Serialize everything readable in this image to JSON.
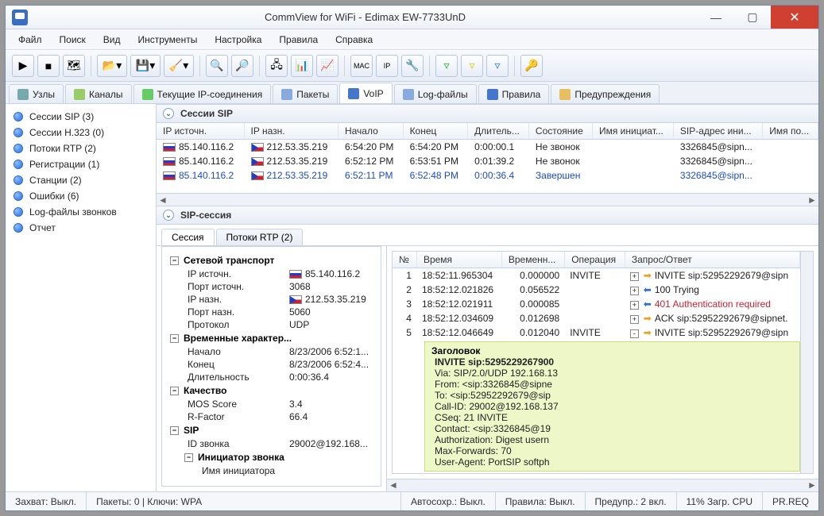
{
  "title": "CommView for WiFi - Edimax EW-7733UnD",
  "menu": [
    "Файл",
    "Поиск",
    "Вид",
    "Инструменты",
    "Настройка",
    "Правила",
    "Справка"
  ],
  "maintabs": [
    {
      "label": "Узлы",
      "icon": "#7aa"
    },
    {
      "label": "Каналы",
      "icon": "#9c6"
    },
    {
      "label": "Текущие IP-соединения",
      "icon": "#6c6"
    },
    {
      "label": "Пакеты",
      "icon": "#8ad"
    },
    {
      "label": "VoIP",
      "icon": "#47c",
      "active": true
    },
    {
      "label": "Log-файлы",
      "icon": "#8ad"
    },
    {
      "label": "Правила",
      "icon": "#47c"
    },
    {
      "label": "Предупреждения",
      "icon": "#e6c060"
    }
  ],
  "sidebar": [
    "Сессии SIP  (3)",
    "Сессии H.323 (0)",
    "Потоки RTP (2)",
    "Регистрации (1)",
    "Станции (2)",
    "Ошибки (6)",
    "Log-файлы звонков",
    "Отчет"
  ],
  "sessions_title": "Сессии SIP",
  "sessions_cols": [
    "IP источн.",
    "IP назн.",
    "Начало",
    "Конец",
    "Длитель...",
    "Состояние",
    "Имя инициат...",
    "SIP-адрес ини...",
    "Имя по..."
  ],
  "sessions_rows": [
    {
      "src": "85.140.116.2",
      "dst": "212.53.35.219",
      "start": "6:54:20 PM",
      "end": "6:54:20 PM",
      "dur": "0:00:00.1",
      "state": "Не звонок",
      "init": "",
      "sip": "3326845@sipn..."
    },
    {
      "src": "85.140.116.2",
      "dst": "212.53.35.219",
      "start": "6:52:12 PM",
      "end": "6:53:51 PM",
      "dur": "0:01:39.2",
      "state": "Не звонок",
      "init": "",
      "sip": "3326845@sipn..."
    },
    {
      "src": "85.140.116.2",
      "dst": "212.53.35.219",
      "start": "6:52:11 PM",
      "end": "6:52:48 PM",
      "dur": "0:00:36.4",
      "state": "Завершен",
      "init": "",
      "sip": "3326845@sipn...",
      "sel": true
    }
  ],
  "sip_session_title": "SIP-сессия",
  "subtabs": [
    "Сессия",
    "Потоки RTP (2)"
  ],
  "detail": {
    "net_transport": "Сетевой транспорт",
    "ip_src_k": "IP источн.",
    "ip_src_v": "85.140.116.2",
    "port_src_k": "Порт источн.",
    "port_src_v": "3068",
    "ip_dst_k": "IP назн.",
    "ip_dst_v": "212.53.35.219",
    "port_dst_k": "Порт назн.",
    "port_dst_v": "5060",
    "proto_k": "Протокол",
    "proto_v": "UDP",
    "timing": "Временные характер...",
    "start_k": "Начало",
    "start_v": "8/23/2006 6:52:1...",
    "end_k": "Конец",
    "end_v": "8/23/2006 6:52:4...",
    "dur_k": "Длительность",
    "dur_v": "0:00:36.4",
    "quality": "Качество",
    "mos_k": "MOS Score",
    "mos_v": "3.4",
    "rf_k": "R-Factor",
    "rf_v": "66.4",
    "sip": "SIP",
    "callid_k": "ID звонка",
    "callid_v": "29002@192.168...",
    "caller": "Инициатор звонка",
    "caller_name": "Имя инициатора"
  },
  "msg_cols": [
    "№",
    "Время",
    "Временн...",
    "Операция",
    "Запрос/Ответ"
  ],
  "msgs": [
    {
      "n": "1",
      "t": "18:52:11.965304",
      "dt": "0.000000",
      "op": "INVITE",
      "dir": "out",
      "txt": "INVITE sip:52952292679@sipn",
      "ex": "+"
    },
    {
      "n": "2",
      "t": "18:52:12.021826",
      "dt": "0.056522",
      "op": "",
      "dir": "in",
      "txt": "100 Trying",
      "ex": "+"
    },
    {
      "n": "3",
      "t": "18:52:12.021911",
      "dt": "0.000085",
      "op": "",
      "dir": "in",
      "txt": "401 Authentication required",
      "ex": "+",
      "red": true
    },
    {
      "n": "4",
      "t": "18:52:12.034609",
      "dt": "0.012698",
      "op": "",
      "dir": "out",
      "txt": "ACK sip:52952292679@sipnet.",
      "ex": "+"
    },
    {
      "n": "5",
      "t": "18:52:12.046649",
      "dt": "0.012040",
      "op": "INVITE",
      "dir": "out",
      "txt": "INVITE sip:52952292679@sipn",
      "ex": "-"
    }
  ],
  "headerblock": {
    "title": "Заголовок",
    "lines": [
      "INVITE sip:5295229267900",
      "Via: SIP/2.0/UDP 192.168.13",
      "From: <sip:3326845@sipne",
      "To: <sip:52952292679@sip",
      "Call-ID: 29002@192.168.137",
      "CSeq: 21 INVITE",
      "Contact: <sip:3326845@19",
      "Authorization: Digest usern",
      "Max-Forwards: 70",
      "User-Agent: PortSIP softph"
    ]
  },
  "status": {
    "capture": "Захват: Выкл.",
    "packets": "Пакеты: 0 | Ключи: WPA",
    "autosave": "Автосохр.: Выкл.",
    "rules": "Правила: Выкл.",
    "warn": "Предупр.: 2 вкл.",
    "cpu": "11% Загр. CPU",
    "pr": "PR.REQ"
  }
}
